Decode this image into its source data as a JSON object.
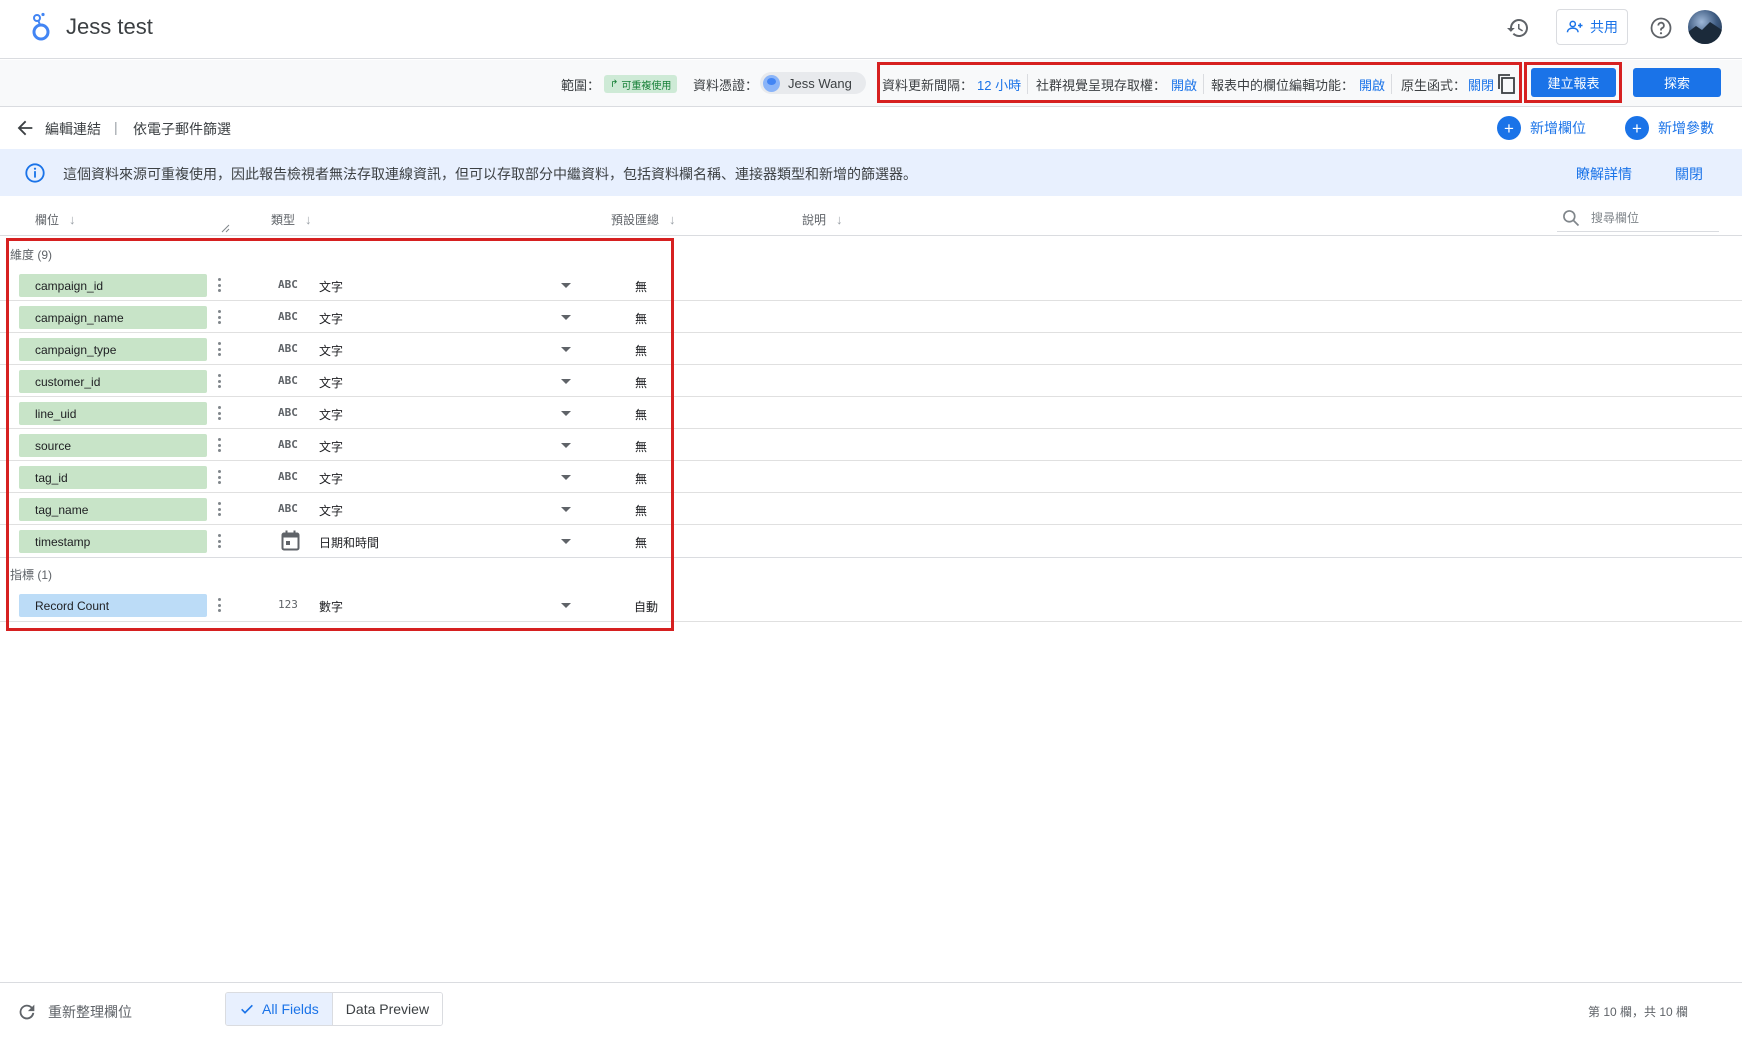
{
  "app": {
    "title": "Jess test",
    "share_label": "共用"
  },
  "toolbar": {
    "scope_label": "範圍：",
    "scope_chip": "可重複使用",
    "credentials_label": "資料憑證：",
    "credentials_user": "Jess Wang",
    "refresh_label": "資料更新間隔：",
    "refresh_value": "12 小時",
    "viewer_label": "社群視覺呈現存取權：",
    "viewer_value": "開啟",
    "edit_label": "報表中的欄位編輯功能：",
    "edit_value": "開啟",
    "native_label": "原生函式：",
    "native_value": "關閉",
    "create_report": "建立報表",
    "explore": "探索"
  },
  "breadcrumb": {
    "back_label": "編輯連結",
    "separator": "|",
    "current": "依電子郵件篩選",
    "add_field": "新增欄位",
    "add_param": "新增參數"
  },
  "banner": {
    "text": "這個資料來源可重複使用，因此報告檢視者無法存取連線資訊，但可以存取部分中繼資料，包括資料欄名稱、連接器類型和新增的篩選器。",
    "learn_more": "瞭解詳情",
    "close": "關閉"
  },
  "columns": {
    "field": "欄位",
    "type": "類型",
    "aggregation": "預設匯總",
    "description": "說明",
    "search_placeholder": "搜尋欄位"
  },
  "dimensions": {
    "label": "維度 (9)",
    "rows": [
      {
        "name": "campaign_id",
        "type_icon": "ABC",
        "type": "文字",
        "agg": "無"
      },
      {
        "name": "campaign_name",
        "type_icon": "ABC",
        "type": "文字",
        "agg": "無"
      },
      {
        "name": "campaign_type",
        "type_icon": "ABC",
        "type": "文字",
        "agg": "無"
      },
      {
        "name": "customer_id",
        "type_icon": "ABC",
        "type": "文字",
        "agg": "無"
      },
      {
        "name": "line_uid",
        "type_icon": "ABC",
        "type": "文字",
        "agg": "無"
      },
      {
        "name": "source",
        "type_icon": "ABC",
        "type": "文字",
        "agg": "無"
      },
      {
        "name": "tag_id",
        "type_icon": "ABC",
        "type": "文字",
        "agg": "無"
      },
      {
        "name": "tag_name",
        "type_icon": "ABC",
        "type": "文字",
        "agg": "無"
      },
      {
        "name": "timestamp",
        "type_icon": "calendar-icon",
        "type": "日期和時間",
        "agg": "無"
      }
    ]
  },
  "metrics": {
    "label": "指標 (1)",
    "rows": [
      {
        "name": "Record Count",
        "type_icon": "123",
        "type": "數字",
        "agg": "自動"
      }
    ]
  },
  "footer": {
    "refresh_fields": "重新整理欄位",
    "all_fields": "All Fields",
    "data_preview": "Data Preview",
    "count": "第 10 欄，共 10 欄"
  },
  "colors": {
    "accent": "#1a73e8",
    "dimension_pill": "#c8e4c8",
    "metric_pill": "#bcdcf7",
    "banner_bg": "#e8f0fe",
    "highlight_box": "#d62020"
  }
}
